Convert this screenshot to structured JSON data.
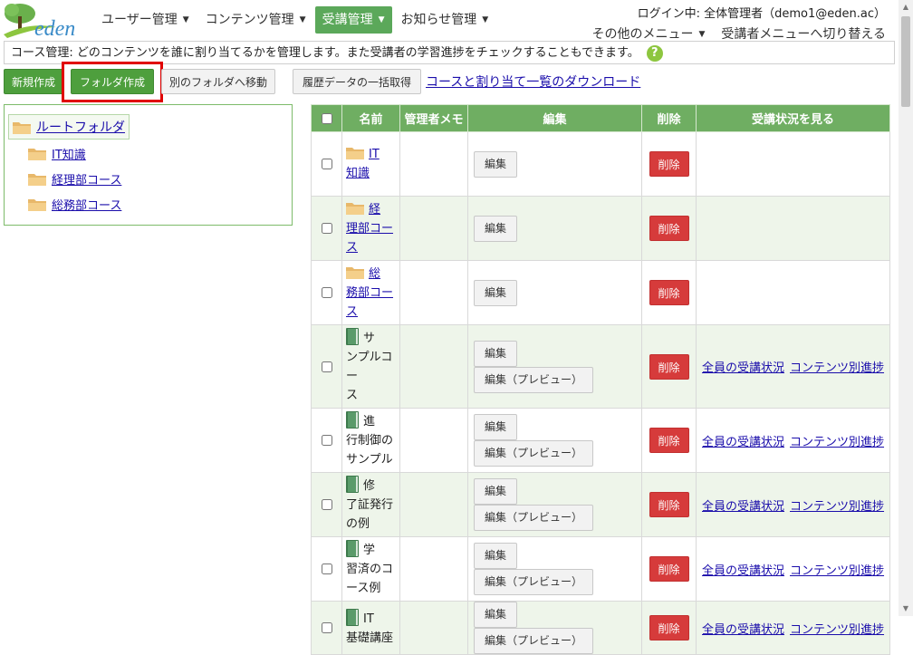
{
  "header": {
    "logo_text": "eden",
    "nav": [
      {
        "label": "ユーザー管理",
        "active": false
      },
      {
        "label": "コンテンツ管理",
        "active": false
      },
      {
        "label": "受講管理",
        "active": true
      },
      {
        "label": "お知らせ管理",
        "active": false
      }
    ],
    "login_info": "ログイン中: 全体管理者（demo1@eden.ac）",
    "other_menu": "その他のメニュー",
    "switch_menu": "受講者メニューへ切り替える"
  },
  "notice": {
    "text": "コース管理: どのコンテンツを誰に割り当てるかを管理します。また受講者の学習進捗をチェックすることもできます。",
    "help_icon": "?"
  },
  "toolbar": {
    "new": "新規作成",
    "folder": "フォルダ作成",
    "move": "別のフォルダへ移動",
    "history": "履歴データの一括取得",
    "download": "コースと割り当て一覧のダウンロード"
  },
  "tree": {
    "root": "ルートフォルダ",
    "children": [
      "IT知識",
      "経理部コース",
      "総務部コース"
    ]
  },
  "table": {
    "headers": [
      "名前",
      "管理者メモ",
      "編集",
      "削除",
      "受講状況を見る"
    ],
    "edit_label": "編集",
    "preview_label": "編集（プレビュー）",
    "delete_label": "削除",
    "status_all": "全員の受講状況",
    "status_content": "コンテンツ別進捗",
    "rows": [
      {
        "type": "folder",
        "name_lines": [
          "IT",
          "知識"
        ]
      },
      {
        "type": "folder",
        "name_lines": [
          "経",
          "理部コー",
          "ス"
        ]
      },
      {
        "type": "folder",
        "name_lines": [
          "総",
          "務部コー",
          "ス"
        ]
      },
      {
        "type": "course",
        "name_lines": [
          "サ",
          "ンプルコー",
          "ス"
        ]
      },
      {
        "type": "course",
        "name_lines": [
          "進",
          "行制御の",
          "サンプル"
        ]
      },
      {
        "type": "course",
        "name_lines": [
          "修",
          "了証発行",
          "の例"
        ]
      },
      {
        "type": "course",
        "name_lines": [
          "学",
          "習済のコ",
          "ース例"
        ]
      },
      {
        "type": "course",
        "name_lines": [
          "IT",
          "基礎講座"
        ]
      }
    ]
  },
  "colors": {
    "accent_green": "#4e9f3d",
    "header_green": "#6fae62",
    "delete_red": "#d63b3b",
    "highlight_red": "#e00000"
  }
}
